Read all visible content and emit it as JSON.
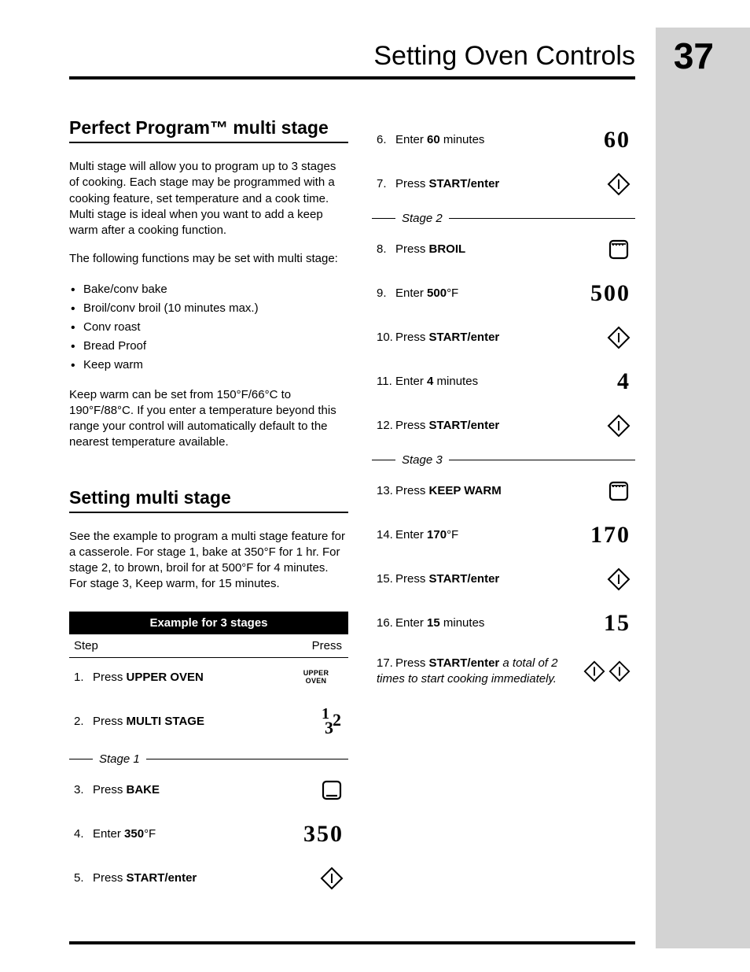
{
  "header": {
    "title": "Setting Oven Controls",
    "page_number": "37"
  },
  "section1": {
    "title": "Perfect Program™ multi stage",
    "para1": "Multi stage will allow you to program up to 3 stages of cooking. Each stage may be programmed with a cooking feature, set temperature and a cook time. Multi stage is ideal when you want to add a keep warm after a cooking function.",
    "para2": "The following functions may be set with multi stage:",
    "bullets": [
      "Bake/conv bake",
      "Broil/conv broil (10 minutes max.)",
      "Conv roast",
      "Bread Proof",
      "Keep warm"
    ],
    "para3": "Keep warm can be set from 150°F/66°C to 190°F/88°C. If you enter a temperature beyond this range your control will automatically default to the nearest temperature available."
  },
  "section2": {
    "title": "Setting multi stage",
    "para1": "See the example to program a multi stage feature for a casserole. For stage 1, bake at 350°F for 1 hr. For stage 2, to brown, broil for at 500°F for 4 minutes. For stage 3, Keep warm, for 15 minutes."
  },
  "table": {
    "title": "Example for 3 stages",
    "head_step": "Step",
    "head_press": "Press",
    "stage1_label": "Stage 1",
    "stage2_label": "Stage 2",
    "stage3_label": "Stage 3",
    "upper_oven": "UPPER OVEN",
    "steps": {
      "s1": {
        "pre": "Press ",
        "bold": "UPPER OVEN"
      },
      "s2": {
        "pre": "Press ",
        "bold": "MULTI STAGE"
      },
      "s3": {
        "pre": "Press ",
        "bold": "BAKE"
      },
      "s4": {
        "pre": "Enter ",
        "bold": "350",
        "post": "°F",
        "display": "350"
      },
      "s5": {
        "pre": "Press ",
        "bold": "START/enter"
      },
      "s6": {
        "pre": "Enter ",
        "bold": "60",
        "post": " minutes",
        "display": "60"
      },
      "s7": {
        "pre": "Press ",
        "bold": "START/enter"
      },
      "s8": {
        "pre": "Press ",
        "bold": "BROIL"
      },
      "s9": {
        "pre": "Enter ",
        "bold": "500",
        "post": "°F",
        "display": "500"
      },
      "s10": {
        "pre": "Press ",
        "bold": "START/enter"
      },
      "s11": {
        "pre": "Enter ",
        "bold": "4",
        "post": " minutes",
        "display": "4"
      },
      "s12": {
        "pre": "Press ",
        "bold": "START/enter"
      },
      "s13": {
        "pre": "Press ",
        "bold": "KEEP WARM"
      },
      "s14": {
        "pre": "Enter ",
        "bold": "170",
        "post": "°F",
        "display": "170"
      },
      "s15": {
        "pre": "Press ",
        "bold": "START/enter"
      },
      "s16": {
        "pre": "Enter ",
        "bold": "15",
        "post": " minutes",
        "display": "15"
      },
      "s17": {
        "pre": "Press ",
        "bold": "START/enter",
        "post_italic": " a total of 2 times to start cooking immediately."
      }
    }
  }
}
